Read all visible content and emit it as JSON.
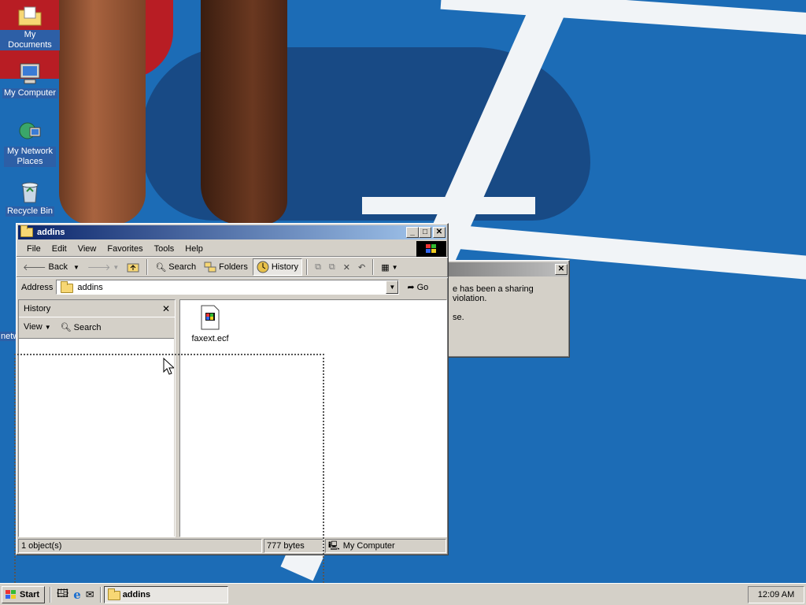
{
  "desktop": {
    "icons": [
      {
        "label": "My Documents",
        "icon": "my-documents-icon"
      },
      {
        "label": "My Computer",
        "icon": "my-computer-icon"
      },
      {
        "label": "My Network Places",
        "icon": "network-places-icon"
      },
      {
        "label": "Recycle Bin",
        "icon": "recycle-bin-icon"
      }
    ],
    "partial_label": "netw"
  },
  "dialog": {
    "message_line1": "e has been a sharing violation.",
    "message_line2": "se.",
    "close": "✕"
  },
  "explorer": {
    "title": "addins",
    "menu": [
      "File",
      "Edit",
      "View",
      "Favorites",
      "Tools",
      "Help"
    ],
    "toolbar": {
      "back": "Back",
      "search": "Search",
      "folders": "Folders",
      "history": "History"
    },
    "address": {
      "label": "Address",
      "value": "addins",
      "go": "Go"
    },
    "history_pane": {
      "title": "History",
      "view": "View",
      "search": "Search"
    },
    "files": [
      {
        "name": "faxext.ecf",
        "icon": "ecf-file-icon"
      }
    ],
    "status": {
      "objects": "1 object(s)",
      "size": "777 bytes",
      "zone": "My Computer"
    }
  },
  "taskbar": {
    "start": "Start",
    "task": "addins",
    "clock": "12:09 AM"
  },
  "colors": {
    "titlebar_active": "#0a246a",
    "face": "#d4d0c8",
    "desktop": "#1c6cb6"
  }
}
